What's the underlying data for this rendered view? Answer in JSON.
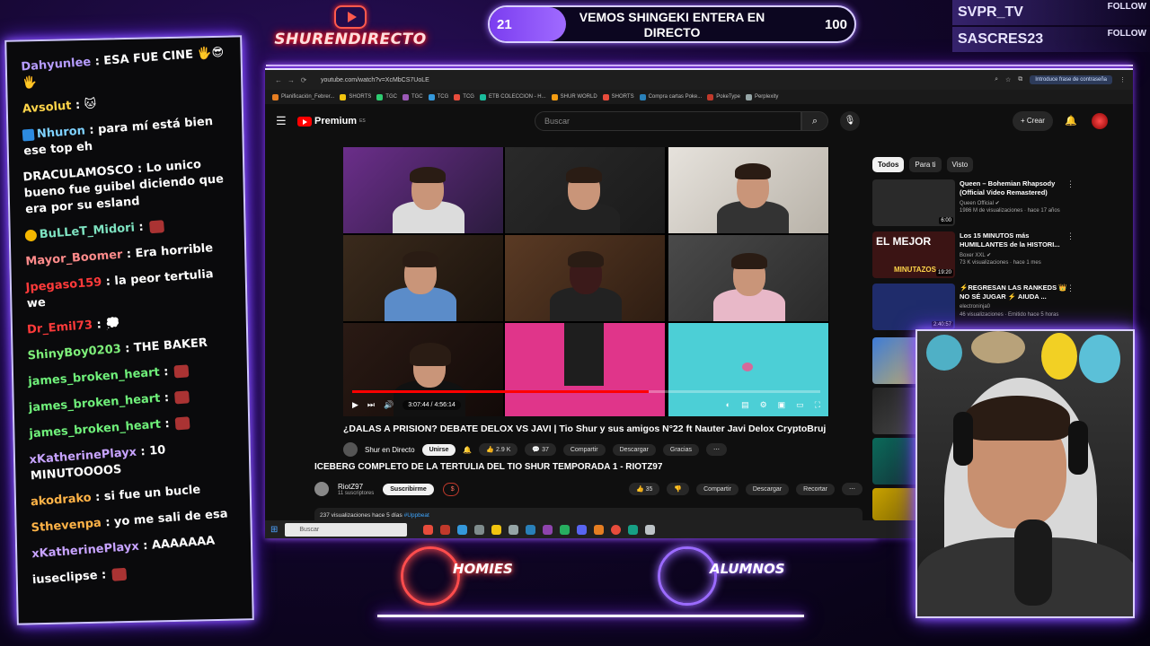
{
  "stream": {
    "brand": "SHURENDIRECTO",
    "goal": {
      "current": "21",
      "target": "100",
      "title": "VEMOS SHINGEKI ENTERA EN DIRECTO",
      "progress": 0.21
    },
    "socials": [
      {
        "name": "SVPR_TV",
        "action": "FOLLOW"
      },
      {
        "name": "SASCRES23",
        "action": "FOLLOW"
      }
    ],
    "teams": [
      {
        "name": "HOMIES",
        "color": "#ff4d4d"
      },
      {
        "name": "ALUMNOS",
        "color": "#9b6bff"
      }
    ]
  },
  "chat": {
    "messages": [
      {
        "user": "Dahyunlee",
        "color": "#b69cff",
        "text": "ESA FUE CINE 🖐😎🖐",
        "badge": "",
        "emote": false
      },
      {
        "user": "Avsolut",
        "color": "#ffd54a",
        "text": "🐱",
        "badge": "",
        "emote": false
      },
      {
        "user": "Nhuron",
        "color": "#7fd2ff",
        "text": "para mí está bien ese top eh",
        "badge": "blue",
        "emote": false
      },
      {
        "user": "DRACULAMOSCO",
        "color": "#ffffff",
        "text": "Lo unico bueno fue guibel diciendo que era por su esland",
        "badge": "",
        "emote": false
      },
      {
        "user": "BuLLeT_Midori",
        "color": "#7ee3c1",
        "text": "",
        "badge": "gold",
        "emote": true
      },
      {
        "user": "Mayor_Boomer",
        "color": "#ff8b8b",
        "text": "Era horrible",
        "badge": "",
        "emote": false
      },
      {
        "user": "Jpegaso159",
        "color": "#ff3a3a",
        "text": "la peor tertulia we",
        "badge": "",
        "emote": false
      },
      {
        "user": "Dr_Emil73",
        "color": "#ff3a3a",
        "text": "💭",
        "badge": "",
        "emote": false
      },
      {
        "user": "ShinyBoy0203",
        "color": "#7ef07a",
        "text": "THE BAKER",
        "badge": "",
        "emote": false
      },
      {
        "user": "james_broken_heart",
        "color": "#6ff07a",
        "text": "",
        "badge": "",
        "emote": true
      },
      {
        "user": "james_broken_heart",
        "color": "#6ff07a",
        "text": "",
        "badge": "",
        "emote": true
      },
      {
        "user": "james_broken_heart",
        "color": "#6ff07a",
        "text": "",
        "badge": "",
        "emote": true
      },
      {
        "user": "xKatherinePlayx",
        "color": "#c7a3ff",
        "text": "10 MINUTOOOOS",
        "badge": "",
        "emote": false
      },
      {
        "user": "akodrako",
        "color": "#ffb347",
        "text": "si fue un bucle",
        "badge": "",
        "emote": false
      },
      {
        "user": "Sthevenpa",
        "color": "#ffb347",
        "text": "yo me sali de esa",
        "badge": "",
        "emote": false
      },
      {
        "user": "xKatherinePlayx",
        "color": "#c7a3ff",
        "text": "AAAAAAA",
        "badge": "",
        "emote": false
      },
      {
        "user": "iuseclipse",
        "color": "#ffffff",
        "text": "",
        "badge": "",
        "emote": true
      }
    ]
  },
  "browser": {
    "url": "youtube.com/watch?v=XcMbCS7UoLE",
    "password_ext": "Introduce frase de contraseña",
    "bookmarks": [
      "Planificación_Febrer...",
      "SHORTS",
      "TGC",
      "TGC",
      "TCG",
      "TCG",
      "ETB COLECCION - H...",
      "SHUR WORLD",
      "SHORTS",
      "Compra cartas Poke...",
      "PokeType",
      "Perplexity"
    ]
  },
  "youtube": {
    "logo": "Premium",
    "logo_sup": "ES",
    "search_placeholder": "Buscar",
    "create": "Crear",
    "player": {
      "time": "3:07:44 / 4:56:14",
      "progress": 0.633
    },
    "video_title": "¿DALAS A PRISION? DEBATE DELOX VS JAVI | Tio Shur y sus amigos N°22 ft Nauter Javi Delox CryptoBruj",
    "channel": "Shur en Directo",
    "join": "Unirse",
    "likes": "2.9 K",
    "comments": "37",
    "share": "Compartir",
    "download": "Descargar",
    "thanks": "Gracias",
    "second": {
      "title": "ICEBERG COMPLETO DE LA TERTULIA DEL TIO SHUR TEMPORADA 1 - RIOTZ97",
      "channel": "RiotZ97",
      "subs": "11 suscriptores",
      "subscribe": "Suscribirme",
      "likes": "35",
      "share": "Compartir",
      "download": "Descargar",
      "clip": "Recortar",
      "views": "237 visualizaciones  hace 5 días",
      "hashtag": "#Uppbeat"
    },
    "chips": [
      "Todos",
      "Para ti",
      "Visto"
    ],
    "recs": [
      {
        "title": "Queen – Bohemian Rhapsody (Official Video Remastered)",
        "channel": "Queen Official ✔",
        "meta": "1986 M de visualizaciones · hace 17 años",
        "duration": "6:00",
        "color": "#2a2a2a"
      },
      {
        "title": "Los 15 MINUTOS más HUMILLANTES de la HISTORI...",
        "channel": "Boxer XXL ✔",
        "meta": "73 K visualizaciones · hace 1 mes",
        "duration": "19:20",
        "color": "#3b1414",
        "overlay": "EL MEJOR",
        "overlay2": "MINUTAZOS"
      },
      {
        "title": "⚡REGRESAN LAS RANKEDS 👑 NO SÉ JUGAR ⚡ AIUDA ...",
        "channel": "electroninja0",
        "meta": "46 visualizaciones · Emitido hace 5 horas",
        "duration": "2:40:57",
        "color": "#1f2c6b"
      }
    ]
  },
  "taskbar": {
    "search": "Buscar"
  }
}
